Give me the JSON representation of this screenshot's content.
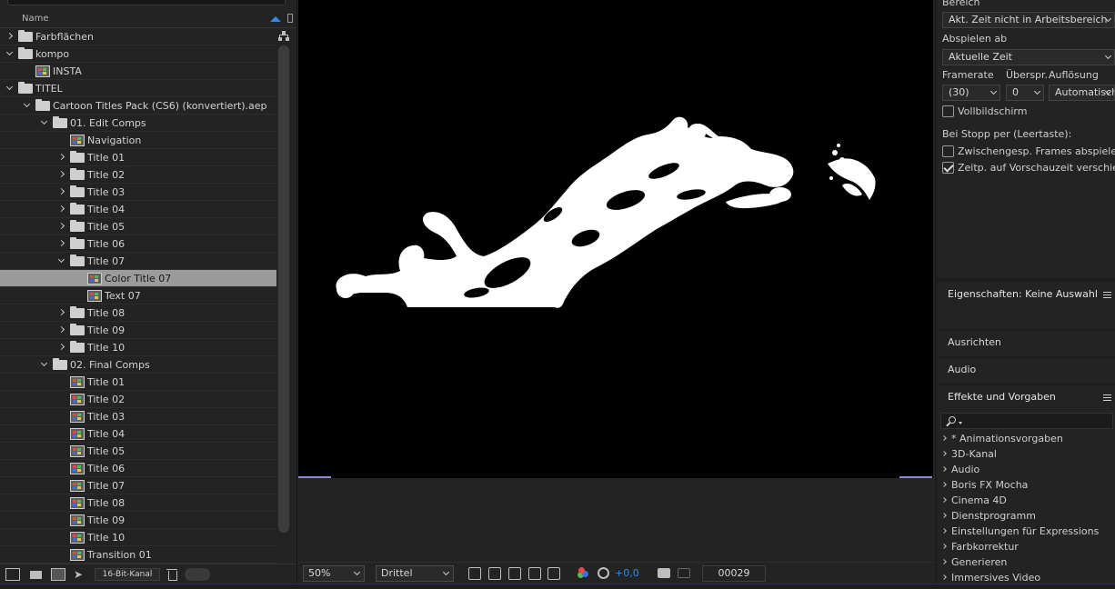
{
  "project": {
    "name_column": "Name",
    "tree": [
      {
        "label": "Farbflächen",
        "depth": 0,
        "kind": "folder",
        "expanded": false
      },
      {
        "label": "kompo",
        "depth": 0,
        "kind": "folder",
        "expanded": true
      },
      {
        "label": "INSTA",
        "depth": 1,
        "kind": "comp"
      },
      {
        "label": "TITEL",
        "depth": 0,
        "kind": "folder",
        "expanded": true
      },
      {
        "label": "Cartoon Titles Pack (CS6) (konvertiert).aep",
        "depth": 1,
        "kind": "folder",
        "expanded": true
      },
      {
        "label": "01. Edit Comps",
        "depth": 2,
        "kind": "folder",
        "expanded": true
      },
      {
        "label": "Navigation",
        "depth": 3,
        "kind": "comp"
      },
      {
        "label": "Title 01",
        "depth": 3,
        "kind": "folder",
        "expanded": false
      },
      {
        "label": "Title 02",
        "depth": 3,
        "kind": "folder",
        "expanded": false
      },
      {
        "label": "Title 03",
        "depth": 3,
        "kind": "folder",
        "expanded": false
      },
      {
        "label": "Title 04",
        "depth": 3,
        "kind": "folder",
        "expanded": false
      },
      {
        "label": "Title 05",
        "depth": 3,
        "kind": "folder",
        "expanded": false
      },
      {
        "label": "Title 06",
        "depth": 3,
        "kind": "folder",
        "expanded": false
      },
      {
        "label": "Title 07",
        "depth": 3,
        "kind": "folder",
        "expanded": true
      },
      {
        "label": "Color Title 07",
        "depth": 4,
        "kind": "comp",
        "selected": true
      },
      {
        "label": "Text 07",
        "depth": 4,
        "kind": "comp"
      },
      {
        "label": "Title 08",
        "depth": 3,
        "kind": "folder",
        "expanded": false
      },
      {
        "label": "Title 09",
        "depth": 3,
        "kind": "folder",
        "expanded": false
      },
      {
        "label": "Title 10",
        "depth": 3,
        "kind": "folder",
        "expanded": false
      },
      {
        "label": "02. Final Comps",
        "depth": 2,
        "kind": "folder",
        "expanded": true
      },
      {
        "label": "Title 01",
        "depth": 3,
        "kind": "comp"
      },
      {
        "label": "Title 02",
        "depth": 3,
        "kind": "comp"
      },
      {
        "label": "Title 03",
        "depth": 3,
        "kind": "comp"
      },
      {
        "label": "Title 04",
        "depth": 3,
        "kind": "comp"
      },
      {
        "label": "Title 05",
        "depth": 3,
        "kind": "comp"
      },
      {
        "label": "Title 06",
        "depth": 3,
        "kind": "comp"
      },
      {
        "label": "Title 07",
        "depth": 3,
        "kind": "comp"
      },
      {
        "label": "Title 08",
        "depth": 3,
        "kind": "comp"
      },
      {
        "label": "Title 09",
        "depth": 3,
        "kind": "comp"
      },
      {
        "label": "Title 10",
        "depth": 3,
        "kind": "comp"
      },
      {
        "label": "Transition 01",
        "depth": 3,
        "kind": "comp"
      }
    ],
    "footer": {
      "bit_depth": "16-Bit-Kanal"
    }
  },
  "viewer": {
    "zoom": "50%",
    "resolution": "Drittel",
    "exposure": "+0,0",
    "timecode": "00029"
  },
  "preview": {
    "range_label": "Bereich",
    "range_value": "Akt. Zeit nicht in Arbeitsbereich",
    "play_from_label": "Abspielen ab",
    "play_from_value": "Aktuelle Zeit",
    "framerate_label": "Framerate",
    "skip_label": "Überspr.",
    "resolution_label": "Auflösung",
    "framerate_value": "(30)",
    "skip_value": "0",
    "resolution_value": "Automatisch",
    "fullscreen_label": "Vollbildschirm",
    "fullscreen_checked": false,
    "on_stop_label": "Bei Stopp per (Leertaste):",
    "cached_frames_label": "Zwischengesp. Frames abspielen",
    "cached_frames_checked": false,
    "move_time_label": "Zeitp. auf Vorschauzeit verschieben",
    "move_time_checked": true
  },
  "panels": {
    "properties_title": "Eigenschaften: Keine Auswahl",
    "align_title": "Ausrichten",
    "audio_title": "Audio",
    "effects_title": "Effekte und Vorgaben"
  },
  "effects": [
    "* Animationsvorgaben",
    "3D-Kanal",
    "Audio",
    "Boris FX Mocha",
    "Cinema 4D",
    "Dienstprogramm",
    "Einstellungen für Expressions",
    "Farbkorrektur",
    "Generieren",
    "Immersives Video"
  ],
  "colors": {
    "accent": "#2d8ceb",
    "selection": "#9b9b9b",
    "canvas": "#000000",
    "splash": "#ffffff"
  }
}
